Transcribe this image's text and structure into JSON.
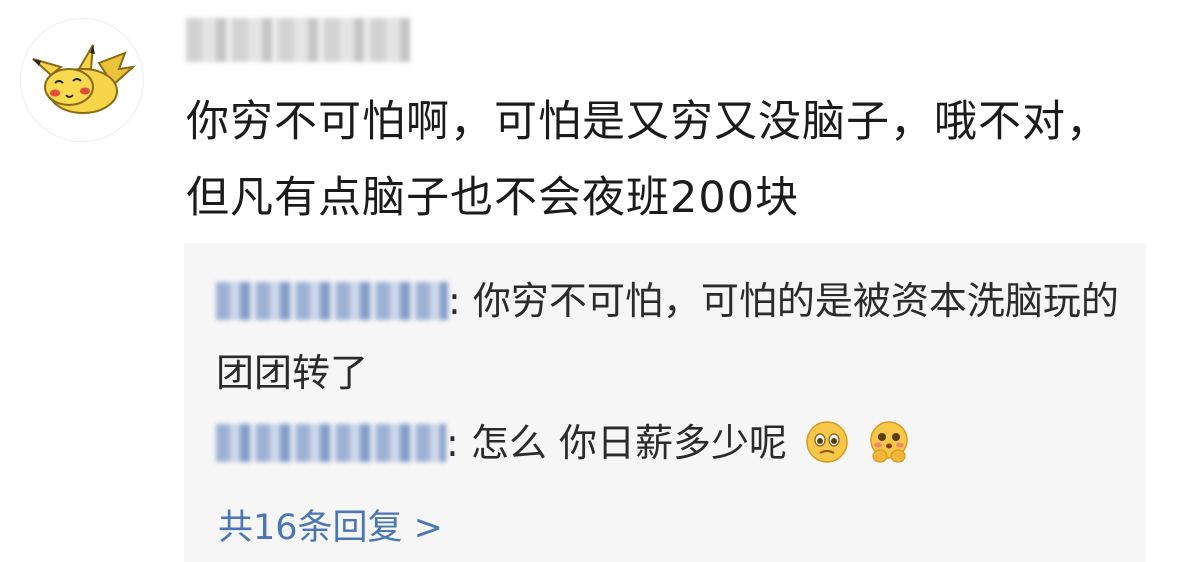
{
  "comment": {
    "text": "你穷不可怕啊，可怕是又穷又没脑子，哦不对，但凡有点脑子也不会夜班200块"
  },
  "replies": [
    {
      "text": "你穷不可怕，可怕的是被资本洗脑玩的团团转了"
    },
    {
      "text": "怎么 你日薪多少呢",
      "emojis": [
        "pleading-face-icon",
        "hugging-face-icon"
      ]
    }
  ],
  "more_replies": {
    "label": "共16条回复 >"
  },
  "colors": {
    "link": "#4a76b5",
    "reply_background": "#f6f6f6",
    "text": "#1b1b1b"
  }
}
